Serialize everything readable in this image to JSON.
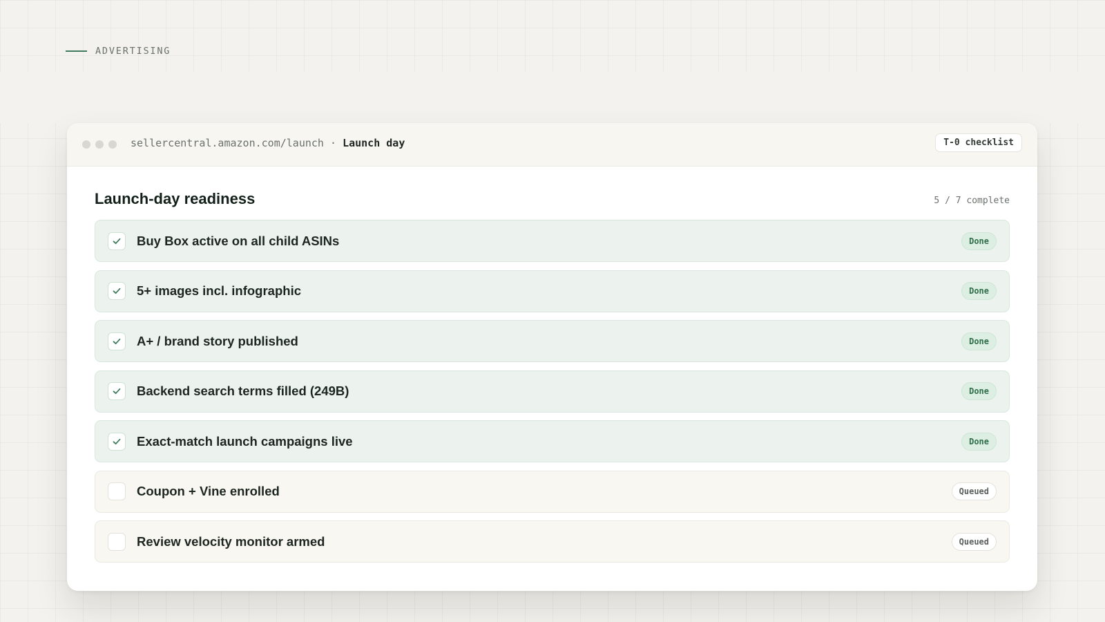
{
  "section": {
    "label": "ADVERTISING"
  },
  "window": {
    "url": "sellercentral.amazon.com/launch",
    "separator": "·",
    "page_name": "Launch day",
    "chip_label": "T-0 checklist"
  },
  "checklist": {
    "title": "Launch-day readiness",
    "progress": "5 / 7 complete",
    "completed_count": 5,
    "total_count": 7,
    "items": [
      {
        "label": "Buy Box active on all child ASINs",
        "status": "Done",
        "checked": true
      },
      {
        "label": "5+ images incl. infographic",
        "status": "Done",
        "checked": true
      },
      {
        "label": "A+ / brand story published",
        "status": "Done",
        "checked": true
      },
      {
        "label": "Backend search terms filled (249B)",
        "status": "Done",
        "checked": true
      },
      {
        "label": "Exact-match launch campaigns live",
        "status": "Done",
        "checked": true
      },
      {
        "label": "Coupon + Vine enrolled",
        "status": "Queued",
        "checked": false
      },
      {
        "label": "Review velocity monitor armed",
        "status": "Queued",
        "checked": false
      }
    ]
  },
  "icons": {
    "check": "check-icon",
    "window_dots": "window-control-dots"
  },
  "colors": {
    "accent_green": "#3f7a5c",
    "done_background": "#ecf3ee",
    "queued_background": "#f8f7f2"
  }
}
